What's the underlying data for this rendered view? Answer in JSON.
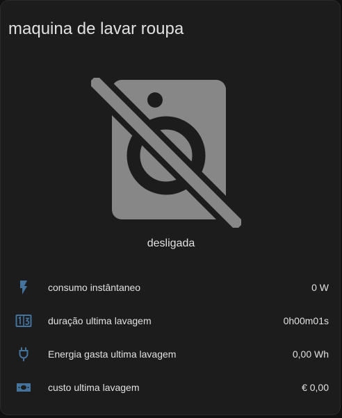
{
  "card": {
    "title": "maquina de lavar roupa",
    "state": "desligada",
    "icon": "washing-machine-off-icon"
  },
  "colors": {
    "card_background": "#1c1c1c",
    "text": "#e1e1e1",
    "device_icon": "#878787",
    "entity_icon": "#44739e"
  },
  "entities": [
    {
      "icon": "flash-icon",
      "label": "consumo instântaneo",
      "value": "0 W"
    },
    {
      "icon": "timer-counter-icon",
      "label": "duração ultima lavagem",
      "value": "0h00m01s"
    },
    {
      "icon": "power-plug-icon",
      "label": "Energia gasta ultima lavagem",
      "value": "0,00 Wh"
    },
    {
      "icon": "cash-icon",
      "label": "custo ultima lavagem",
      "value": "€ 0,00"
    }
  ]
}
